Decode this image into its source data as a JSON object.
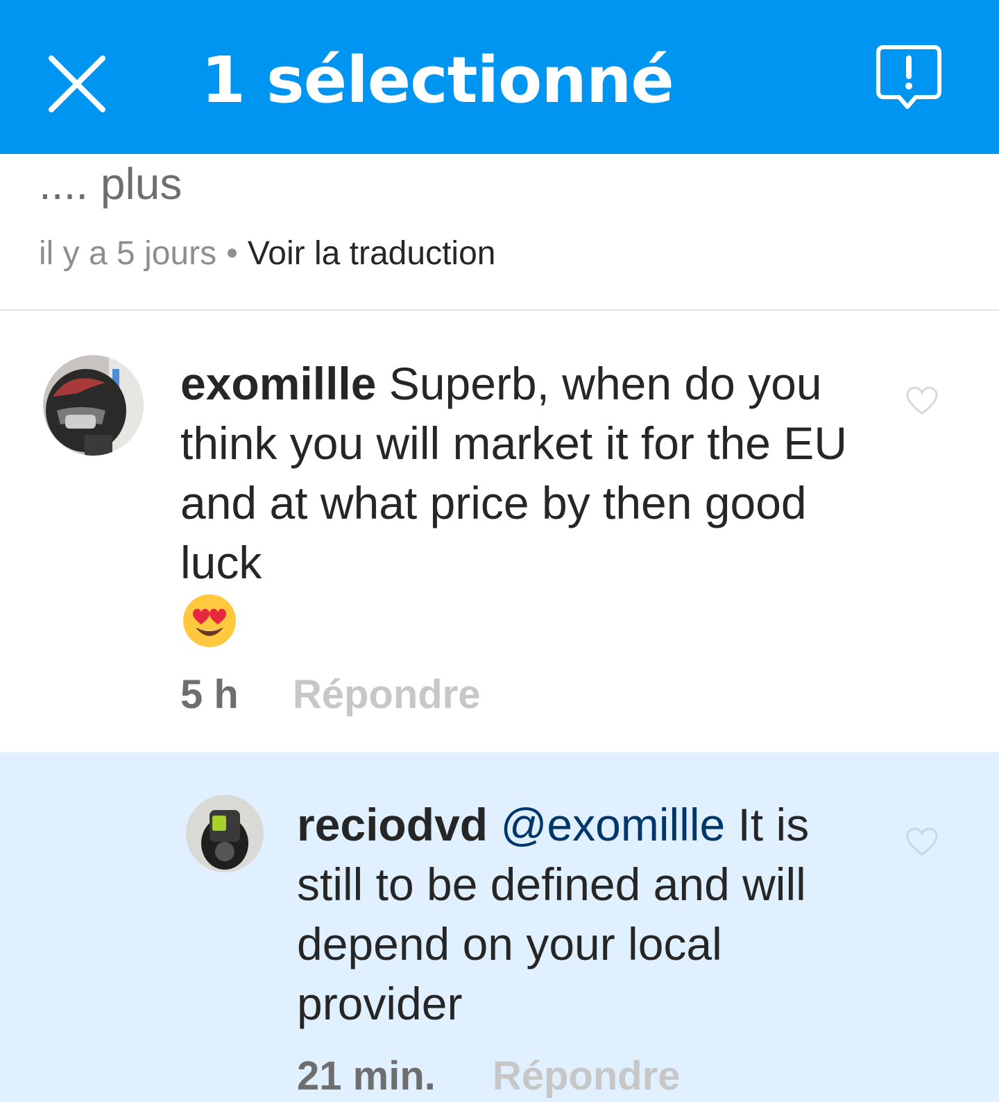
{
  "topbar": {
    "title": "1 sélectionné",
    "close_icon": "close-icon",
    "report_icon": "report-icon"
  },
  "previous_comment": {
    "tail": ".... plus",
    "time": "il y a 5 jours",
    "separator": "•",
    "translate_label": "Voir la traduction"
  },
  "comments": [
    {
      "username": "exomillle",
      "text": " Superb, when do you think you will market it for the EU and at what price by then good luck",
      "emoji": "smiling-face-with-heart-eyes",
      "time": "5 h",
      "reply_label": "Répondre",
      "selected": false
    },
    {
      "username": "reciodvd",
      "mention": "@exomillle",
      "text": " It is still to be defined and will depend on your local provider",
      "time": "21 min.",
      "reply_label": "Répondre",
      "selected": true
    }
  ],
  "colors": {
    "topbar": "#0095f0",
    "selected_bg": "#e0f0ff",
    "mention": "#00376b"
  }
}
